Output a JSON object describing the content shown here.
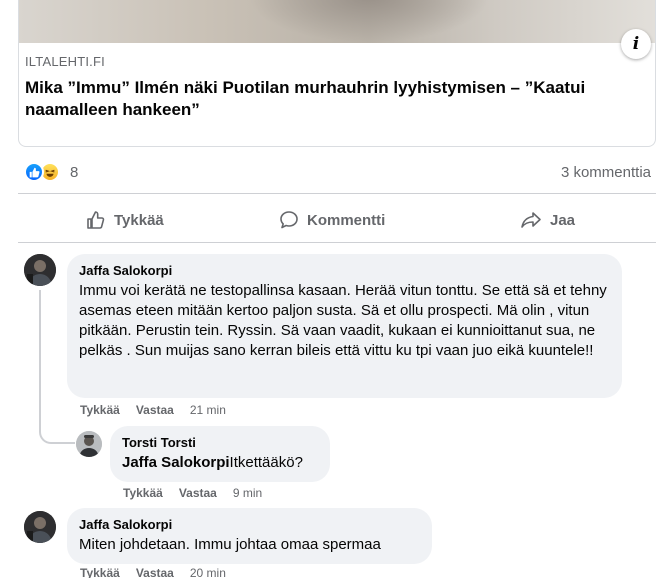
{
  "link_preview": {
    "domain": "ILTALEHTI.FI",
    "title": "Mika ”Immu” Ilmén näki Puotilan murhauhrin lyyhistymisen – ”Kaatui naamalleen hankeen”"
  },
  "reactions": {
    "count": "8",
    "icons": [
      "like-icon",
      "haha-icon"
    ],
    "comment_count": "3 kommenttia"
  },
  "actions": {
    "like": "Tykkää",
    "comment": "Kommentti",
    "share": "Jaa"
  },
  "comments": [
    {
      "author": "Jaffa Salokorpi",
      "text": "Immu voi kerätä ne testopallinsa kasaan. Herää vitun tonttu. Se että sä et tehny asemas eteen mitään kertoo paljon susta. Sä et ollu prospecti. Mä olin , vitun pitkään. Perustin tein. Ryssin. Sä vaan vaadit, kukaan ei kunnioittanut sua, ne pelkäs . Sun muijas sano kerran bileis että vittu ku tpi vaan juo eikä kuuntele!!",
      "like": "Tykkää",
      "reply": "Vastaa",
      "time": "21 min"
    },
    {
      "author": "Torsti Torsti",
      "mention": "Jaffa Salokorpi",
      "text": "Itkettääkö?",
      "like": "Tykkää",
      "reply": "Vastaa",
      "time": "9 min"
    },
    {
      "author": "Jaffa Salokorpi",
      "text": "Miten johdetaan. Immu johtaa omaa spermaa",
      "like": "Tykkää",
      "reply": "Vastaa",
      "time": "20 min"
    }
  ],
  "colors": {
    "secondary_text": "#65676b",
    "bubble_bg": "#f0f2f5",
    "divider": "#ced0d4",
    "like_blue": "#0866ff"
  }
}
